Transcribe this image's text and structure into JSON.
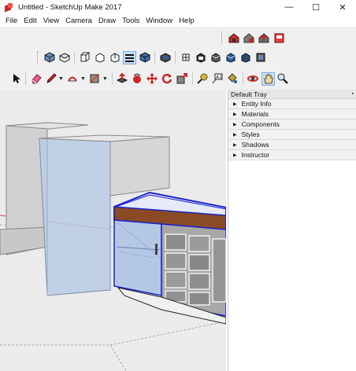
{
  "window": {
    "title": "Untitled - SketchUp Make 2017",
    "minimize_glyph": "—",
    "maximize_glyph": "☐",
    "close_glyph": "✕"
  },
  "menu": [
    "File",
    "Edit",
    "View",
    "Camera",
    "Draw",
    "Tools",
    "Window",
    "Help"
  ],
  "toolbars": {
    "row1": [
      "warehouse-icon",
      "extension-warehouse-icon",
      "share-model-icon",
      "layout-icon"
    ],
    "row2_views": [
      "iso-view-icon",
      "top-view-icon",
      "front-view-icon",
      "right-view-icon",
      "back-view-icon",
      "left-view-icon"
    ],
    "row2_styles": [
      "xray-icon",
      "back-edges-icon",
      "wireframe-icon",
      "hidden-line-icon",
      "shaded-icon",
      "shaded-textures-icon",
      "monochrome-icon"
    ],
    "row3": [
      "select-icon",
      "eraser-icon",
      "pencil-icon",
      "arc-icon",
      "rectangle-icon",
      "push-pull-icon",
      "follow-me-icon",
      "move-icon",
      "rotate-icon",
      "scale-icon",
      "tape-measure-icon",
      "text-icon",
      "paint-bucket-icon",
      "orbit-icon",
      "pan-icon",
      "zoom-icon"
    ]
  },
  "tray": {
    "title": "Default Tray",
    "pin": "📌",
    "panels": [
      "Entity Info",
      "Materials",
      "Components",
      "Styles",
      "Shadows",
      "Instructor"
    ]
  },
  "colors": {
    "accent_red": "#c8282a",
    "selection_blue": "#1a22c8",
    "wood": "#8a4a24"
  }
}
